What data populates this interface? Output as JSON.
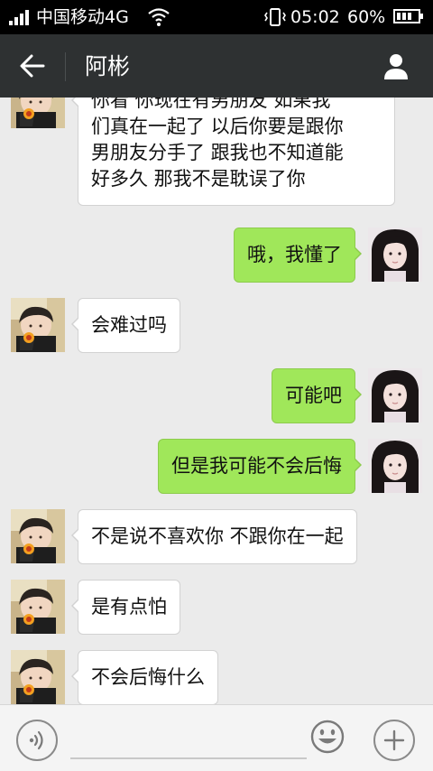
{
  "status_bar": {
    "carrier": "中国移动4G",
    "time": "05:02",
    "battery": "60%"
  },
  "header": {
    "title": "阿彬"
  },
  "messages": [
    {
      "side": "in",
      "lines": [
        "你看 你现在有男朋友 如果我",
        "们真在一起了 以后你要是跟你",
        "男朋友分手了 跟我也不知道能",
        "好多久 那我不是耽误了你"
      ]
    },
    {
      "side": "out",
      "text": "哦，我懂了"
    },
    {
      "side": "in",
      "text": "会难过吗"
    },
    {
      "side": "out",
      "text": "可能吧"
    },
    {
      "side": "out",
      "text": "但是我可能不会后悔"
    },
    {
      "side": "in",
      "text": "不是说不喜欢你 不跟你在一起"
    },
    {
      "side": "in",
      "text": "是有点怕"
    },
    {
      "side": "in",
      "text": "不会后悔什么"
    }
  ],
  "input": {
    "value": "",
    "placeholder": ""
  },
  "icons": {
    "back": "back-arrow-icon",
    "profile": "person-icon",
    "voice": "voice-icon",
    "emoji": "smiley-icon",
    "add": "plus-icon"
  },
  "colors": {
    "header_bg": "#2e3132",
    "outgoing_bubble": "#a0e75a",
    "incoming_bubble": "#ffffff",
    "chat_bg": "#ebebeb"
  }
}
